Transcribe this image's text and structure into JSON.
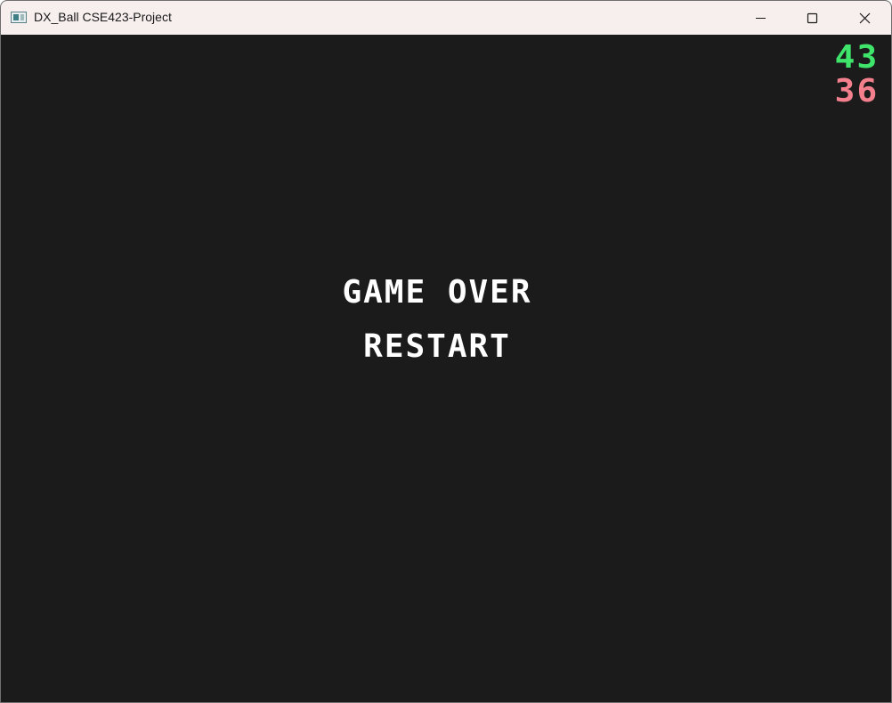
{
  "window": {
    "title": "DX_Ball CSE423-Project",
    "icon": "app-window-icon",
    "controls": {
      "minimize_icon": "minimize-icon",
      "maximize_icon": "maximize-icon",
      "close_icon": "close-icon"
    }
  },
  "hud": {
    "score": "43",
    "second_value": "36",
    "score_color": "#3fe46b",
    "second_value_color": "#f3808c"
  },
  "menu": {
    "game_over": "GAME OVER",
    "restart": "RESTART",
    "text_color": "#ffffff"
  },
  "colors": {
    "background": "#1b1b1b",
    "titlebar": "#f7efee"
  }
}
